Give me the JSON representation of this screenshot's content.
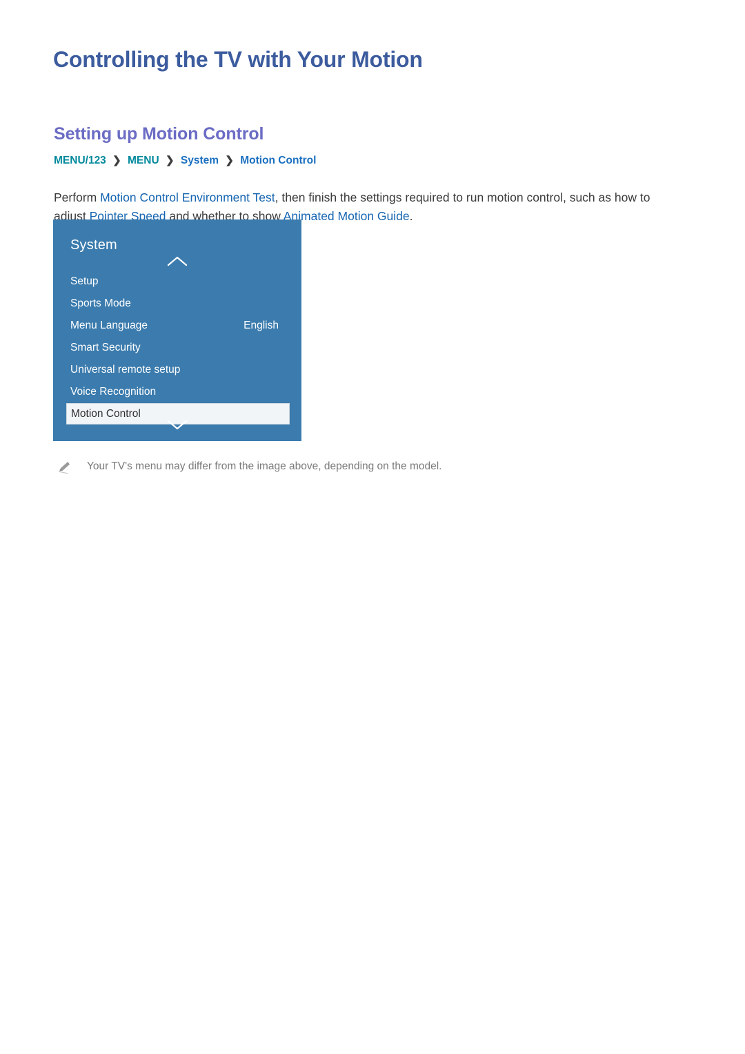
{
  "document": {
    "title": "Controlling the TV with Your Motion",
    "section_title": "Setting up Motion Control"
  },
  "breadcrumb": {
    "items": [
      {
        "label": "MENU/123",
        "style": "teal"
      },
      {
        "label": "MENU",
        "style": "teal"
      },
      {
        "label": "System",
        "style": "blue"
      },
      {
        "label": "Motion Control",
        "style": "blue"
      }
    ],
    "separator": "❯"
  },
  "body": {
    "segment_1": "Perform ",
    "link_1": "Motion Control Environment Test",
    "segment_2": ", then finish the settings required to run motion control, such as how to adjust ",
    "link_2": "Pointer Speed",
    "segment_3": " and whether to show ",
    "link_3": "Animated Motion Guide",
    "segment_4": "."
  },
  "tv_menu": {
    "title": "System",
    "scroll_up_icon": "chevron-up-icon",
    "scroll_down_icon": "chevron-down-icon",
    "items": [
      {
        "label": "Setup",
        "value": "",
        "selected": false
      },
      {
        "label": "Sports Mode",
        "value": "",
        "selected": false
      },
      {
        "label": "Menu Language",
        "value": "English",
        "selected": false
      },
      {
        "label": "Smart Security",
        "value": "",
        "selected": false
      },
      {
        "label": "Universal remote setup",
        "value": "",
        "selected": false
      },
      {
        "label": "Voice Recognition",
        "value": "",
        "selected": false
      },
      {
        "label": "Motion Control",
        "value": "",
        "selected": true
      }
    ]
  },
  "note": {
    "icon": "pencil-icon",
    "text": "Your TV's menu may differ from the image above, depending on the model."
  },
  "colors": {
    "title_blue": "#3c5c9e",
    "section_purple": "#6b6cc4",
    "crumb_teal": "#00899c",
    "crumb_blue": "#1a6fbf",
    "body_link_blue": "#1565b0",
    "tv_panel_blue": "#3b7bad",
    "tv_selected_bg": "#f1f5f8",
    "note_gray": "#7b7b7b"
  }
}
